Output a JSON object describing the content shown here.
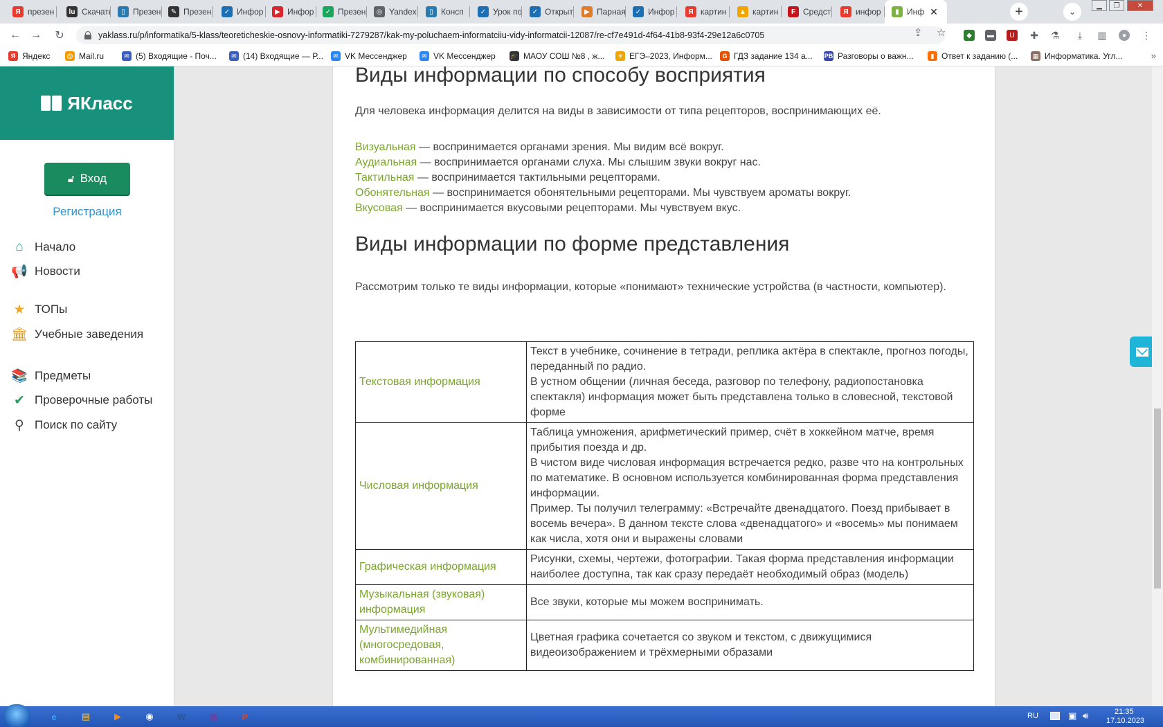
{
  "colors": {
    "brand": "#18917c",
    "login_button": "#1a8a5f",
    "link": "#3593c9",
    "term_green": "#7aa62b"
  },
  "browser": {
    "tabs": [
      {
        "title": "презен",
        "icon": "yandex-icon",
        "color": "#e63b2e",
        "letter": "Я"
      },
      {
        "title": "Скачать",
        "icon": "lu-icon",
        "color": "#333333",
        "letter": "lu"
      },
      {
        "title": "Презен",
        "icon": "book-icon",
        "color": "#2a7ab0",
        "letter": "▯"
      },
      {
        "title": "Презен",
        "icon": "edit-icon",
        "color": "#333333",
        "letter": "✎"
      },
      {
        "title": "Инфор",
        "icon": "check-icon",
        "color": "#1d6fb5",
        "letter": "✓"
      },
      {
        "title": "Инфор",
        "icon": "play-icon",
        "color": "#d9262c",
        "letter": "▶"
      },
      {
        "title": "Презен",
        "icon": "check-circle-icon",
        "color": "#19a65b",
        "letter": "✓"
      },
      {
        "title": "Yandex",
        "icon": "globe-icon",
        "color": "#5f6368",
        "letter": "◎"
      },
      {
        "title": "Консп",
        "icon": "book-icon",
        "color": "#2a7ab0",
        "letter": "▯"
      },
      {
        "title": "Урок по",
        "icon": "check-icon",
        "color": "#1d6fb5",
        "letter": "✓"
      },
      {
        "title": "Открыт",
        "icon": "check-icon",
        "color": "#1d6fb5",
        "letter": "✓"
      },
      {
        "title": "Парная",
        "icon": "slides-icon",
        "color": "#e07b2a",
        "letter": "▶"
      },
      {
        "title": "Инфор",
        "icon": "check-icon",
        "color": "#1d6fb5",
        "letter": "✓"
      },
      {
        "title": "картин",
        "icon": "yandex-icon",
        "color": "#e63b2e",
        "letter": "Я"
      },
      {
        "title": "картин",
        "icon": "image-icon",
        "color": "#f0a500",
        "letter": "▲"
      },
      {
        "title": "Средст",
        "icon": "f-icon",
        "color": "#c4161c",
        "letter": "F"
      },
      {
        "title": "инфор",
        "icon": "yandex-icon",
        "color": "#e63b2e",
        "letter": "Я"
      },
      {
        "title": "Инф",
        "icon": "yaklass-icon",
        "color": "#7cb342",
        "letter": "▮"
      }
    ],
    "url": "yaklass.ru/p/informatika/5-klass/teoreticheskie-osnovy-informatiki-7279287/kak-my-poluchaem-informatciiu-vidy-informatcii-12087/re-cf7e491d-4f64-41b8-93f4-29e12a6c0705",
    "bookmarks": [
      {
        "label": "Яндекс",
        "icon": "yandex-icon",
        "color": "#e63b2e",
        "letter": "Я"
      },
      {
        "label": "Mail.ru",
        "icon": "mailru-icon",
        "color": "#f59a00",
        "letter": "@"
      },
      {
        "label": "(5) Входящие - Поч...",
        "icon": "mail-icon",
        "color": "#3b5fc0",
        "letter": "✉"
      },
      {
        "label": "(14) Входящие — Р...",
        "icon": "mail-icon",
        "color": "#3b5fc0",
        "letter": "✉"
      },
      {
        "label": "VK Мессенджер",
        "icon": "vk-icon",
        "color": "#2787f5",
        "letter": "✉"
      },
      {
        "label": "VK Мессенджер",
        "icon": "vk-icon",
        "color": "#2787f5",
        "letter": "✉"
      },
      {
        "label": "МАОУ СОШ №8 , ж...",
        "icon": "school-icon",
        "color": "#333333",
        "letter": "🎓"
      },
      {
        "label": "ЕГЭ–2023, Информ...",
        "icon": "sun-icon",
        "color": "#f0a500",
        "letter": "☀"
      },
      {
        "label": "ГДЗ задание 134 а...",
        "icon": "gdz-icon",
        "color": "#e65100",
        "letter": "G"
      },
      {
        "label": "Разговоры о важн...",
        "icon": "pb-icon",
        "color": "#3949ab",
        "letter": "РВ"
      },
      {
        "label": "Ответ к заданию (...",
        "icon": "bars-icon",
        "color": "#ff6f00",
        "letter": "▮"
      },
      {
        "label": "Информатика. Угл...",
        "icon": "image-icon",
        "color": "#8d6e63",
        "letter": "▦"
      }
    ]
  },
  "sidebar": {
    "logo": "ЯКласс",
    "login": "Вход",
    "register": "Регистрация",
    "nav": [
      {
        "label": "Начало",
        "icon": "home-icon",
        "glyph": "⌂",
        "color": "#1aa09a"
      },
      {
        "label": "Новости",
        "icon": "megaphone-icon",
        "glyph": "📢",
        "color": "#2a8fc4"
      },
      {
        "label": "ТОПы",
        "icon": "star-icon",
        "glyph": "★",
        "color": "#f5a623"
      },
      {
        "label": "Учебные заведения",
        "icon": "building-icon",
        "glyph": "🏛",
        "color": "#e09a1f"
      },
      {
        "label": "Предметы",
        "icon": "books-icon",
        "glyph": "📚",
        "color": "#2a9d5c"
      },
      {
        "label": "Проверочные работы",
        "icon": "check-circle-icon",
        "glyph": "✔",
        "color": "#2a9d5c"
      },
      {
        "label": "Поиск по сайту",
        "icon": "search-icon",
        "glyph": "⚲",
        "color": "#444444"
      }
    ]
  },
  "content": {
    "heading1": "Виды информации по способу восприятия",
    "intro1": "Для человека информация делится на виды в зависимости от типа рецепторов, воспринимающих её.",
    "perception": [
      {
        "term": "Визуальная",
        "desc": " — воспринимается органами зрения. Мы видим всё вокруг."
      },
      {
        "term": "Аудиальная",
        "desc": " — воспринимается органами слуха. Мы слышим звуки вокруг нас."
      },
      {
        "term": "Тактильная",
        "desc": " — воспринимается тактильными рецепторами."
      },
      {
        "term": "Обонятельная",
        "desc": " — воспринимается обонятельными рецепторами. Мы чувствуем ароматы вокруг."
      },
      {
        "term": "Вкусовая",
        "desc": " — воспринимается вкусовыми рецепторами. Мы чувствуем вкус."
      }
    ],
    "heading2": "Виды информации по форме представления",
    "intro2": "Рассмотрим только те виды информации, которые «понимают» технические устройства (в частности, компьютер).",
    "table": [
      {
        "type": "Текстовая информация",
        "desc": [
          "Текст в учебнике, сочинение в тетради, реплика актёра в спектакле, прогноз погоды, переданный по радио.",
          "В устном общении (личная беседа, разговор по телефону, радиопостановка спектакля) информация может быть представлена только в словесной, текстовой форме"
        ]
      },
      {
        "type": "Числовая информация",
        "desc": [
          "Таблица умножения, арифметический пример, счёт в хоккейном матче, время прибытия поезда и др.",
          "В чистом виде числовая информация встречается редко, разве что на контрольных по математике. В основном используется комбинированная форма представления информации.",
          "Пример. Ты получил телеграмму: «Встречайте двенадцатого. Поезд прибывает в восемь вечера». В данном тексте слова «двенадцатого» и «восемь» мы понимаем как числа, хотя они и выражены словами"
        ]
      },
      {
        "type": "Графическая информация",
        "desc": [
          "Рисунки, схемы, чертежи, фотографии. Такая форма представления информации наиболее доступна, так как сразу передаёт необходимый образ (модель)"
        ]
      },
      {
        "type": "Музыкальная (звуковая) информация",
        "desc": [
          "Все звуки, которые мы можем воспринимать."
        ]
      },
      {
        "type": "Мультимедийная (многосредовая, комбинированная)",
        "desc": [
          "Цветная графика сочетается со звуком и текстом, с движущимися видеоизображением и трёхмерными образами"
        ]
      }
    ]
  },
  "taskbar": {
    "lang": "RU",
    "time": "21:35",
    "date": "17.10.2023",
    "apps": [
      {
        "icon": "ie-icon",
        "glyph": "e",
        "color": "#3aa0ff"
      },
      {
        "icon": "folder-icon",
        "glyph": "▤",
        "color": "#f2c55c"
      },
      {
        "icon": "media-player-icon",
        "glyph": "▶",
        "color": "#f08a1c"
      },
      {
        "icon": "chrome-icon",
        "glyph": "◉",
        "color": "#ffffff"
      },
      {
        "icon": "word-icon",
        "glyph": "W",
        "color": "#2b5797"
      },
      {
        "icon": "archive-icon",
        "glyph": "▦",
        "color": "#6b3fa0"
      },
      {
        "icon": "powerpoint-icon",
        "glyph": "P",
        "color": "#d24726"
      }
    ]
  }
}
